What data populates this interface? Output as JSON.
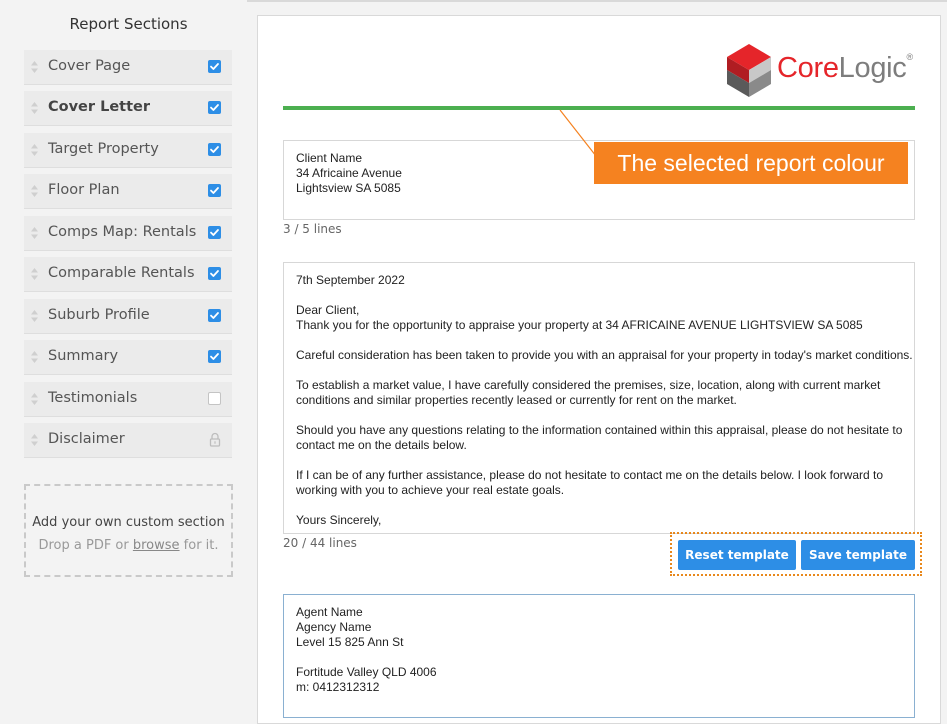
{
  "sidebar": {
    "title": "Report Sections",
    "items": [
      {
        "label": "Cover Page",
        "state": "checked",
        "bold": false
      },
      {
        "label": "Cover Letter",
        "state": "checked",
        "bold": true
      },
      {
        "label": "Target Property",
        "state": "checked",
        "bold": false
      },
      {
        "label": "Floor Plan",
        "state": "checked",
        "bold": false
      },
      {
        "label": "Comps Map: Rentals",
        "state": "checked",
        "bold": false
      },
      {
        "label": "Comparable Rentals",
        "state": "checked",
        "bold": false
      },
      {
        "label": "Suburb Profile",
        "state": "checked",
        "bold": false
      },
      {
        "label": "Summary",
        "state": "checked",
        "bold": false
      },
      {
        "label": "Testimonials",
        "state": "unchecked",
        "bold": false
      },
      {
        "label": "Disclaimer",
        "state": "locked",
        "bold": false
      }
    ],
    "custom_section": {
      "title": "Add your own custom section",
      "prefix": "Drop a PDF or ",
      "link": "browse",
      "suffix": " for it."
    }
  },
  "main": {
    "logo": {
      "part1": "Core",
      "part2": "Logic",
      "mark": "®"
    },
    "report_colour": "#4caf50",
    "client_block": {
      "lines": [
        "Client Name",
        "34 Africaine Avenue",
        "Lightsview SA 5085"
      ],
      "counter": "3 / 5 lines"
    },
    "letter_block": {
      "lines": [
        "7th September 2022",
        "",
        "Dear Client,",
        "Thank you for the opportunity to appraise your property at 34 AFRICAINE AVENUE LIGHTSVIEW SA 5085",
        "",
        "Careful consideration has been taken to provide you with an appraisal for your property in today's market conditions.",
        "",
        "To establish a market value, I have carefully considered the premises, size, location, along with current market",
        "conditions and similar properties recently leased or currently for rent on the market.",
        "",
        "Should you have any questions relating to the information contained within this appraisal, please do not hesitate to",
        "contact me on the details below.",
        "",
        "If I can be of any further assistance, please do not hesitate to contact me on the details below. I look forward to",
        "working with you to achieve your real estate goals.",
        "",
        "Yours Sincerely,"
      ],
      "counter": "20 / 44 lines"
    },
    "buttons": {
      "reset": "Reset template",
      "save": "Save template"
    },
    "agent_block": {
      "lines": [
        "Agent Name",
        "Agency Name",
        "Level 15 825 Ann St",
        "",
        "Fortitude Valley QLD 4006",
        "m: 0412312312"
      ]
    }
  },
  "annotation": {
    "text": "The selected report colour",
    "color": "#f58220"
  },
  "colors": {
    "accent": "#2d8ee6",
    "brand_red": "#e5252a",
    "brand_grey": "#7d7d7d"
  }
}
